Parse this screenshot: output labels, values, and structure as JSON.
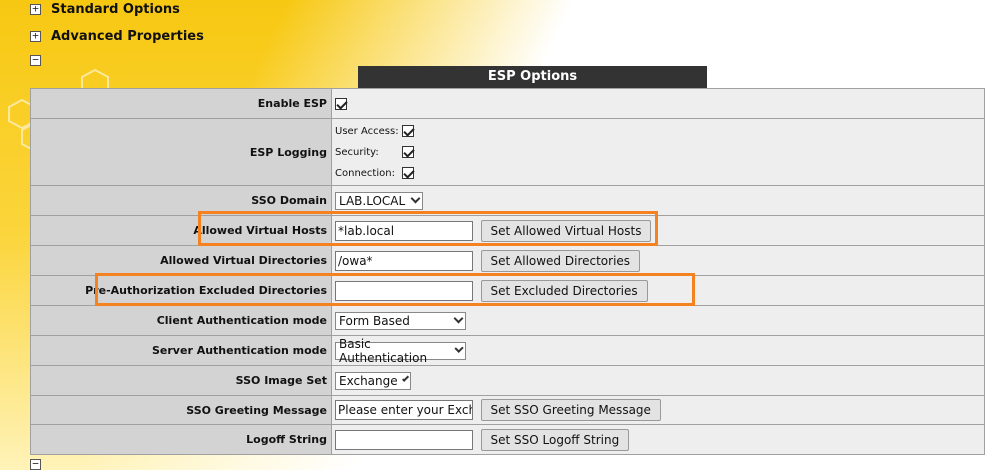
{
  "sections": {
    "standard": "Standard Options",
    "advanced": "Advanced Properties"
  },
  "esp": {
    "header": "ESP Options",
    "enable_label": "Enable ESP",
    "logging_label": "ESP Logging",
    "logging": {
      "user_access": "User Access:",
      "security": "Security:",
      "connection": "Connection:"
    },
    "sso_domain_label": "SSO Domain",
    "sso_domain_value": "LAB.LOCAL",
    "vhosts_label": "Allowed Virtual Hosts",
    "vhosts_value": "*lab.local",
    "vhosts_button": "Set Allowed Virtual Hosts",
    "vdirs_label": "Allowed Virtual Directories",
    "vdirs_value": "/owa*",
    "vdirs_button": "Set Allowed Directories",
    "preauth_label": "Pre-Authorization Excluded Directories",
    "preauth_value": "",
    "preauth_button": "Set Excluded Directories",
    "client_auth_label": "Client Authentication mode",
    "client_auth_value": "Form Based",
    "server_auth_label": "Server Authentication mode",
    "server_auth_value": "Basic Authentication",
    "image_set_label": "SSO Image Set",
    "image_set_value": "Exchange",
    "greeting_label": "SSO Greeting Message",
    "greeting_value": "Please enter your Exchar",
    "greeting_button": "Set SSO Greeting Message",
    "logoff_label": "Logoff String",
    "logoff_value": "",
    "logoff_button": "Set SSO Logoff String"
  },
  "colors": {
    "highlight": "#f58220",
    "header_bg": "#333333",
    "label_bg": "#d3d3d3",
    "page_yellow": "#f7c812"
  }
}
